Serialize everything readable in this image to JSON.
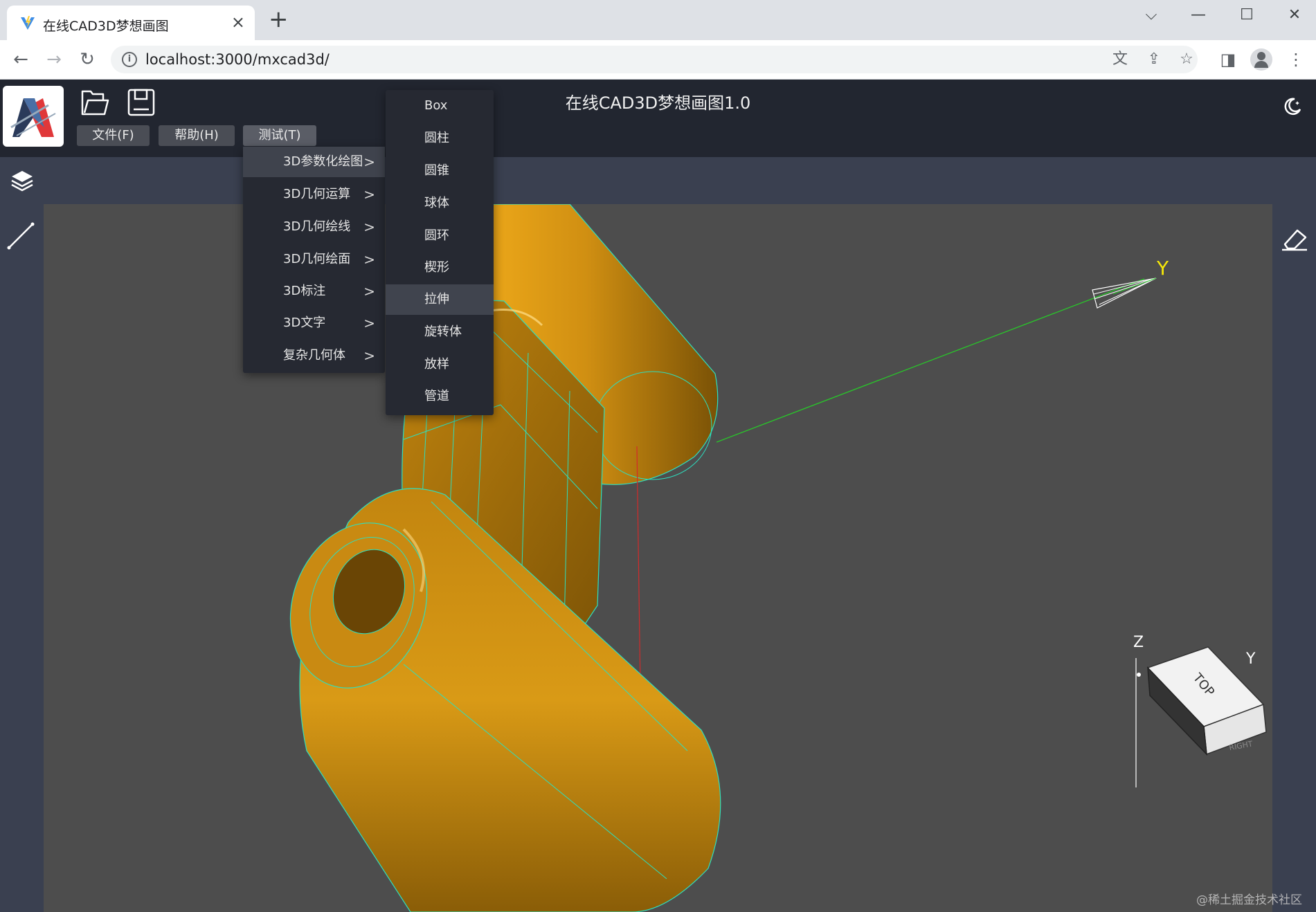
{
  "browser": {
    "tab_title": "在线CAD3D梦想画图",
    "tab_close": "×",
    "new_tab": "+",
    "url": "localhost:3000/mxcad3d/",
    "window_controls": {
      "dropdown": "⌵",
      "minimize": "—",
      "maximize": "☐",
      "close": "✕"
    },
    "icons": [
      "back-arrow-icon",
      "forward-arrow-icon",
      "reload-icon",
      "info-icon",
      "translate-icon",
      "share-icon",
      "star-icon",
      "sidepanel-icon",
      "profile-icon",
      "kebab-menu-icon"
    ]
  },
  "app": {
    "title": "在线CAD3D梦想画图1.0",
    "menus": {
      "file": "文件(F)",
      "help": "帮助(H)",
      "test": "测试(T)"
    },
    "test_menu": [
      {
        "label": "3D参数化绘图",
        "chev": ">"
      },
      {
        "label": "3D几何运算",
        "chev": ">"
      },
      {
        "label": "3D几何绘线",
        "chev": ">"
      },
      {
        "label": "3D几何绘面",
        "chev": ">"
      },
      {
        "label": "3D标注",
        "chev": ">"
      },
      {
        "label": "3D文字",
        "chev": ">"
      },
      {
        "label": "复杂几何体",
        "chev": ">"
      }
    ],
    "submenu": [
      {
        "label": "Box"
      },
      {
        "label": "圆柱"
      },
      {
        "label": "圆锥"
      },
      {
        "label": "球体"
      },
      {
        "label": "圆环"
      },
      {
        "label": "楔形"
      },
      {
        "label": "拉伸"
      },
      {
        "label": "旋转体"
      },
      {
        "label": "放样"
      },
      {
        "label": "管道"
      }
    ],
    "hovered_menu_item": "3D参数化绘图",
    "hovered_submenu_item": "拉伸"
  },
  "scene": {
    "axis_label_y": "Y",
    "cube_labels": {
      "z": "Z",
      "y": "Y",
      "top": "TOP",
      "right": "RIGHT"
    },
    "model_color": "#d08f12",
    "edge_color": "#2de0c0"
  },
  "watermark": "@稀土掘金技术社区",
  "colors": {
    "header_bg": "#222630",
    "toolbar_bg": "#3a4050",
    "viewport_bg": "#4d4d4d",
    "menu_bg": "#262932",
    "axis_green": "#29c52a",
    "axis_label_yellow": "#f5e70a"
  }
}
